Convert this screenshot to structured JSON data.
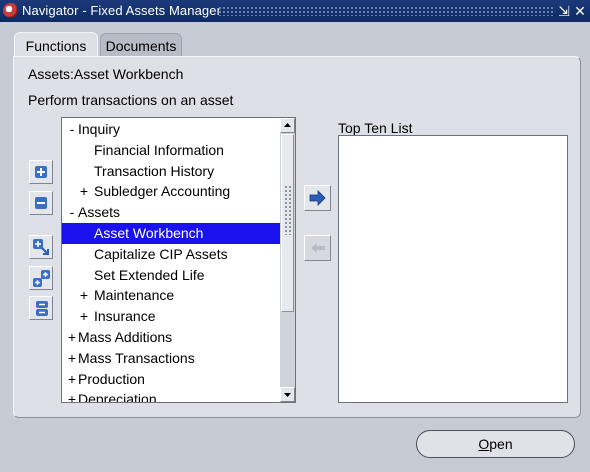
{
  "window": {
    "title": "Navigator - Fixed Assets Manager",
    "minimize_glyph": "⇲",
    "close_glyph": "✕"
  },
  "tabs": [
    {
      "label": "Functions",
      "active": true
    },
    {
      "label": "Documents",
      "active": false
    }
  ],
  "breadcrumb": "Assets:Asset Workbench",
  "instruction": "Perform transactions on an asset",
  "tree": {
    "items": [
      {
        "expander": "-",
        "label": "Inquiry",
        "level": 0
      },
      {
        "expander": "",
        "label": "Financial Information",
        "level": 1
      },
      {
        "expander": "",
        "label": "Transaction History",
        "level": 1
      },
      {
        "expander": "+",
        "label": "Subledger Accounting",
        "level": 1
      },
      {
        "expander": "-",
        "label": "Assets",
        "level": 0
      },
      {
        "expander": "",
        "label": "Asset Workbench",
        "level": 1,
        "selected": true
      },
      {
        "expander": "",
        "label": "Capitalize CIP Assets",
        "level": 1
      },
      {
        "expander": "",
        "label": "Set Extended Life",
        "level": 1
      },
      {
        "expander": "+",
        "label": "Maintenance",
        "level": 1
      },
      {
        "expander": "+",
        "label": "Insurance",
        "level": 1
      },
      {
        "expander": "+",
        "label": "Mass Additions",
        "level": 0
      },
      {
        "expander": "+",
        "label": "Mass Transactions",
        "level": 0
      },
      {
        "expander": "+",
        "label": "Production",
        "level": 0
      },
      {
        "expander": "+",
        "label": "Depreciation",
        "level": 0
      }
    ]
  },
  "top_ten": {
    "label": "Top Ten List",
    "items": []
  },
  "side_buttons": [
    "expand-icon",
    "collapse-icon",
    "expand-branch-icon",
    "expand-all-icon",
    "collapse-all-icon"
  ],
  "move_buttons": [
    "add-to-top-ten-arrow-icon",
    "remove-from-top-ten-arrow-icon"
  ],
  "open_button": {
    "accelerator": "O",
    "rest": "pen"
  },
  "colors": {
    "titlebar": "#0e2a63",
    "selection": "#1a12ee",
    "panel": "#dde0e6",
    "arrow_blue": "#2b5cb8"
  }
}
